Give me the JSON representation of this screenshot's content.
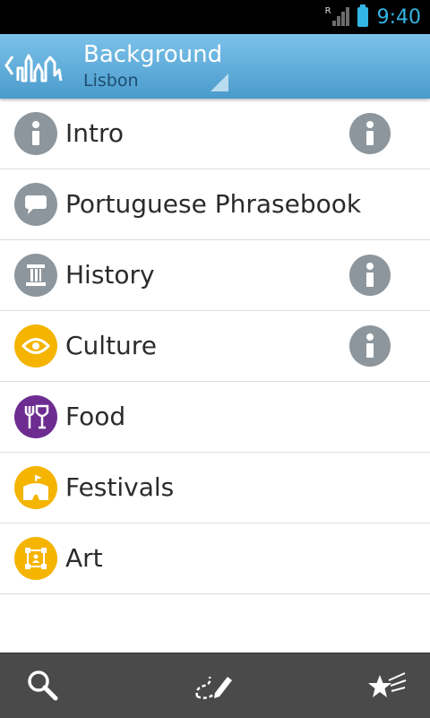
{
  "status_bar": {
    "time": "9:40",
    "roaming_indicator": "R"
  },
  "header": {
    "title": "Background",
    "subtitle": "Lisbon"
  },
  "list": {
    "items": [
      {
        "label": "Intro",
        "icon": "info-icon",
        "icon_color": "#8d969c",
        "has_info_button": true
      },
      {
        "label": "Portuguese Phrasebook",
        "icon": "speech-bubble-icon",
        "icon_color": "#8d969c",
        "has_info_button": false
      },
      {
        "label": "History",
        "icon": "column-icon",
        "icon_color": "#8d969c",
        "has_info_button": true
      },
      {
        "label": "Culture",
        "icon": "eye-icon",
        "icon_color": "#f4b400",
        "has_info_button": true
      },
      {
        "label": "Food",
        "icon": "fork-wine-icon",
        "icon_color": "#6d2c8f",
        "has_info_button": false
      },
      {
        "label": "Festivals",
        "icon": "tent-icon",
        "icon_color": "#f4b400",
        "has_info_button": false
      },
      {
        "label": "Art",
        "icon": "picture-frame-icon",
        "icon_color": "#f4b400",
        "has_info_button": false
      }
    ]
  },
  "bottom_bar": {
    "buttons": [
      "search-icon",
      "route-pencil-icon",
      "stars-icon"
    ]
  },
  "colors": {
    "accent": "#33b5e5",
    "header_top": "#7cc2ea",
    "header_bottom": "#4a9bcc",
    "bottom_bar": "#4a4a4a"
  }
}
